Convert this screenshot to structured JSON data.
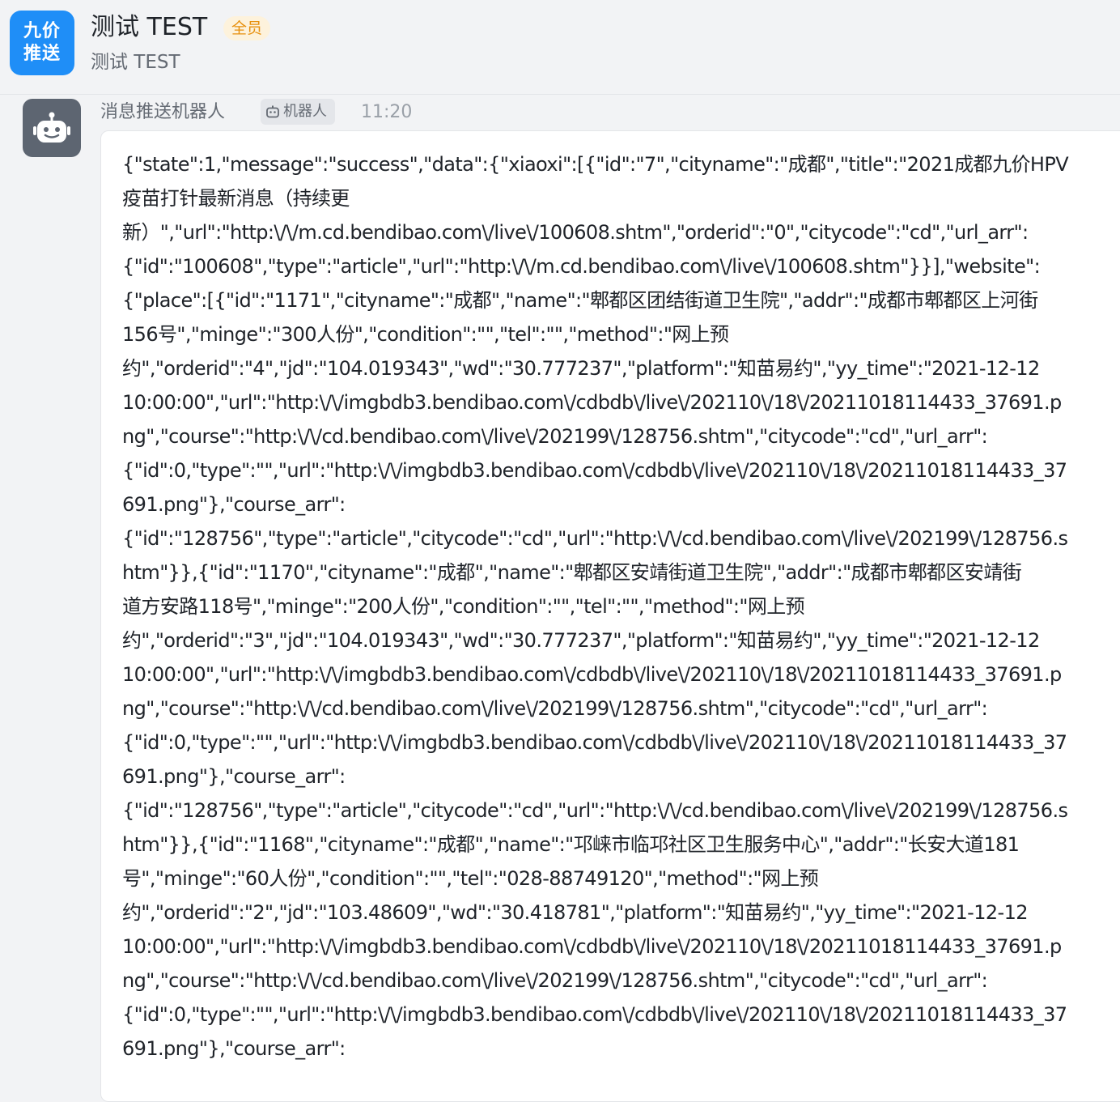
{
  "header": {
    "group_avatar_line1": "九价",
    "group_avatar_line2": "推送",
    "title": "测试 TEST",
    "member_badge": "全员",
    "subtitle": "测试 TEST",
    "accent_color": "#1f8ef7"
  },
  "message": {
    "sender": "消息推送机器人",
    "bot_tag_icon": "robot-icon",
    "bot_tag": "机器人",
    "time": "11:20",
    "lines": [
      "{\"state\":1,\"message\":\"success\",\"data\":{\"xiaoxi\":[{\"id\":\"7\",\"cityname\":\"成都\",\"title\":\"2021成都九价HPV",
      "疫苗打针最新消息（持续更",
      "新）\",\"url\":\"http:\\/\\/m.cd.bendibao.com\\/live\\/100608.shtm\",\"orderid\":\"0\",\"citycode\":\"cd\",\"url_arr\":",
      "{\"id\":\"100608\",\"type\":\"article\",\"url\":\"http:\\/\\/m.cd.bendibao.com\\/live\\/100608.shtm\"}}],\"website\":",
      "{\"place\":[{\"id\":\"1171\",\"cityname\":\"成都\",\"name\":\"郫都区团结街道卫生院\",\"addr\":\"成都市郫都区上河街",
      "156号\",\"minge\":\"300人份\",\"condition\":\"\",\"tel\":\"\",\"method\":\"网上预",
      "约\",\"orderid\":\"4\",\"jd\":\"104.019343\",\"wd\":\"30.777237\",\"platform\":\"知苗易约\",\"yy_time\":\"2021-12-12",
      "10:00:00\",\"url\":\"http:\\/\\/imgbdb3.bendibao.com\\/cdbdb\\/live\\/202110\\/18\\/20211018114433_37691.p",
      "ng\",\"course\":\"http:\\/\\/cd.bendibao.com\\/live\\/202199\\/128756.shtm\",\"citycode\":\"cd\",\"url_arr\":",
      "{\"id\":0,\"type\":\"\",\"url\":\"http:\\/\\/imgbdb3.bendibao.com\\/cdbdb\\/live\\/202110\\/18\\/20211018114433_37",
      "691.png\"},\"course_arr\":",
      "{\"id\":\"128756\",\"type\":\"article\",\"citycode\":\"cd\",\"url\":\"http:\\/\\/cd.bendibao.com\\/live\\/202199\\/128756.s",
      "htm\"}},{\"id\":\"1170\",\"cityname\":\"成都\",\"name\":\"郫都区安靖街道卫生院\",\"addr\":\"成都市郫都区安靖街",
      "道方安路118号\",\"minge\":\"200人份\",\"condition\":\"\",\"tel\":\"\",\"method\":\"网上预",
      "约\",\"orderid\":\"3\",\"jd\":\"104.019343\",\"wd\":\"30.777237\",\"platform\":\"知苗易约\",\"yy_time\":\"2021-12-12",
      "10:00:00\",\"url\":\"http:\\/\\/imgbdb3.bendibao.com\\/cdbdb\\/live\\/202110\\/18\\/20211018114433_37691.p",
      "ng\",\"course\":\"http:\\/\\/cd.bendibao.com\\/live\\/202199\\/128756.shtm\",\"citycode\":\"cd\",\"url_arr\":",
      "{\"id\":0,\"type\":\"\",\"url\":\"http:\\/\\/imgbdb3.bendibao.com\\/cdbdb\\/live\\/202110\\/18\\/20211018114433_37",
      "691.png\"},\"course_arr\":",
      "{\"id\":\"128756\",\"type\":\"article\",\"citycode\":\"cd\",\"url\":\"http:\\/\\/cd.bendibao.com\\/live\\/202199\\/128756.s",
      "htm\"}},{\"id\":\"1168\",\"cityname\":\"成都\",\"name\":\"邛崃市临邛社区卫生服务中心\",\"addr\":\"长安大道181",
      "号\",\"minge\":\"60人份\",\"condition\":\"\",\"tel\":\"028-88749120\",\"method\":\"网上预",
      "约\",\"orderid\":\"2\",\"jd\":\"103.48609\",\"wd\":\"30.418781\",\"platform\":\"知苗易约\",\"yy_time\":\"2021-12-12",
      "10:00:00\",\"url\":\"http:\\/\\/imgbdb3.bendibao.com\\/cdbdb\\/live\\/202110\\/18\\/20211018114433_37691.p",
      "ng\",\"course\":\"http:\\/\\/cd.bendibao.com\\/live\\/202199\\/128756.shtm\",\"citycode\":\"cd\",\"url_arr\":",
      "{\"id\":0,\"type\":\"\",\"url\":\"http:\\/\\/imgbdb3.bendibao.com\\/cdbdb\\/live\\/202110\\/18\\/20211018114433_37",
      "691.png\"},\"course_arr\":"
    ]
  }
}
